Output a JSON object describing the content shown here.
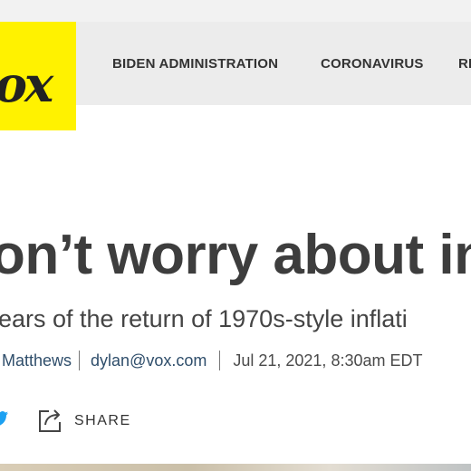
{
  "logo": {
    "text": "ox"
  },
  "nav": {
    "items": [
      {
        "label": "BIDEN ADMINISTRATION"
      },
      {
        "label": "CORONAVIRUS"
      },
      {
        "label": "RE"
      }
    ]
  },
  "article": {
    "headline": "on’t worry about inf",
    "dek": "ears of the return of 1970s-style inflati",
    "byline": {
      "author": "Matthews",
      "email": "dylan@vox.com",
      "date": "Jul 21, 2021, 8:30am EDT"
    },
    "share": {
      "label": "SHARE"
    }
  },
  "colors": {
    "brand_yellow": "#fff200",
    "nav_bg": "#ececec",
    "link": "#2f4e6b"
  },
  "icons": [
    "twitter-icon",
    "share-icon"
  ]
}
